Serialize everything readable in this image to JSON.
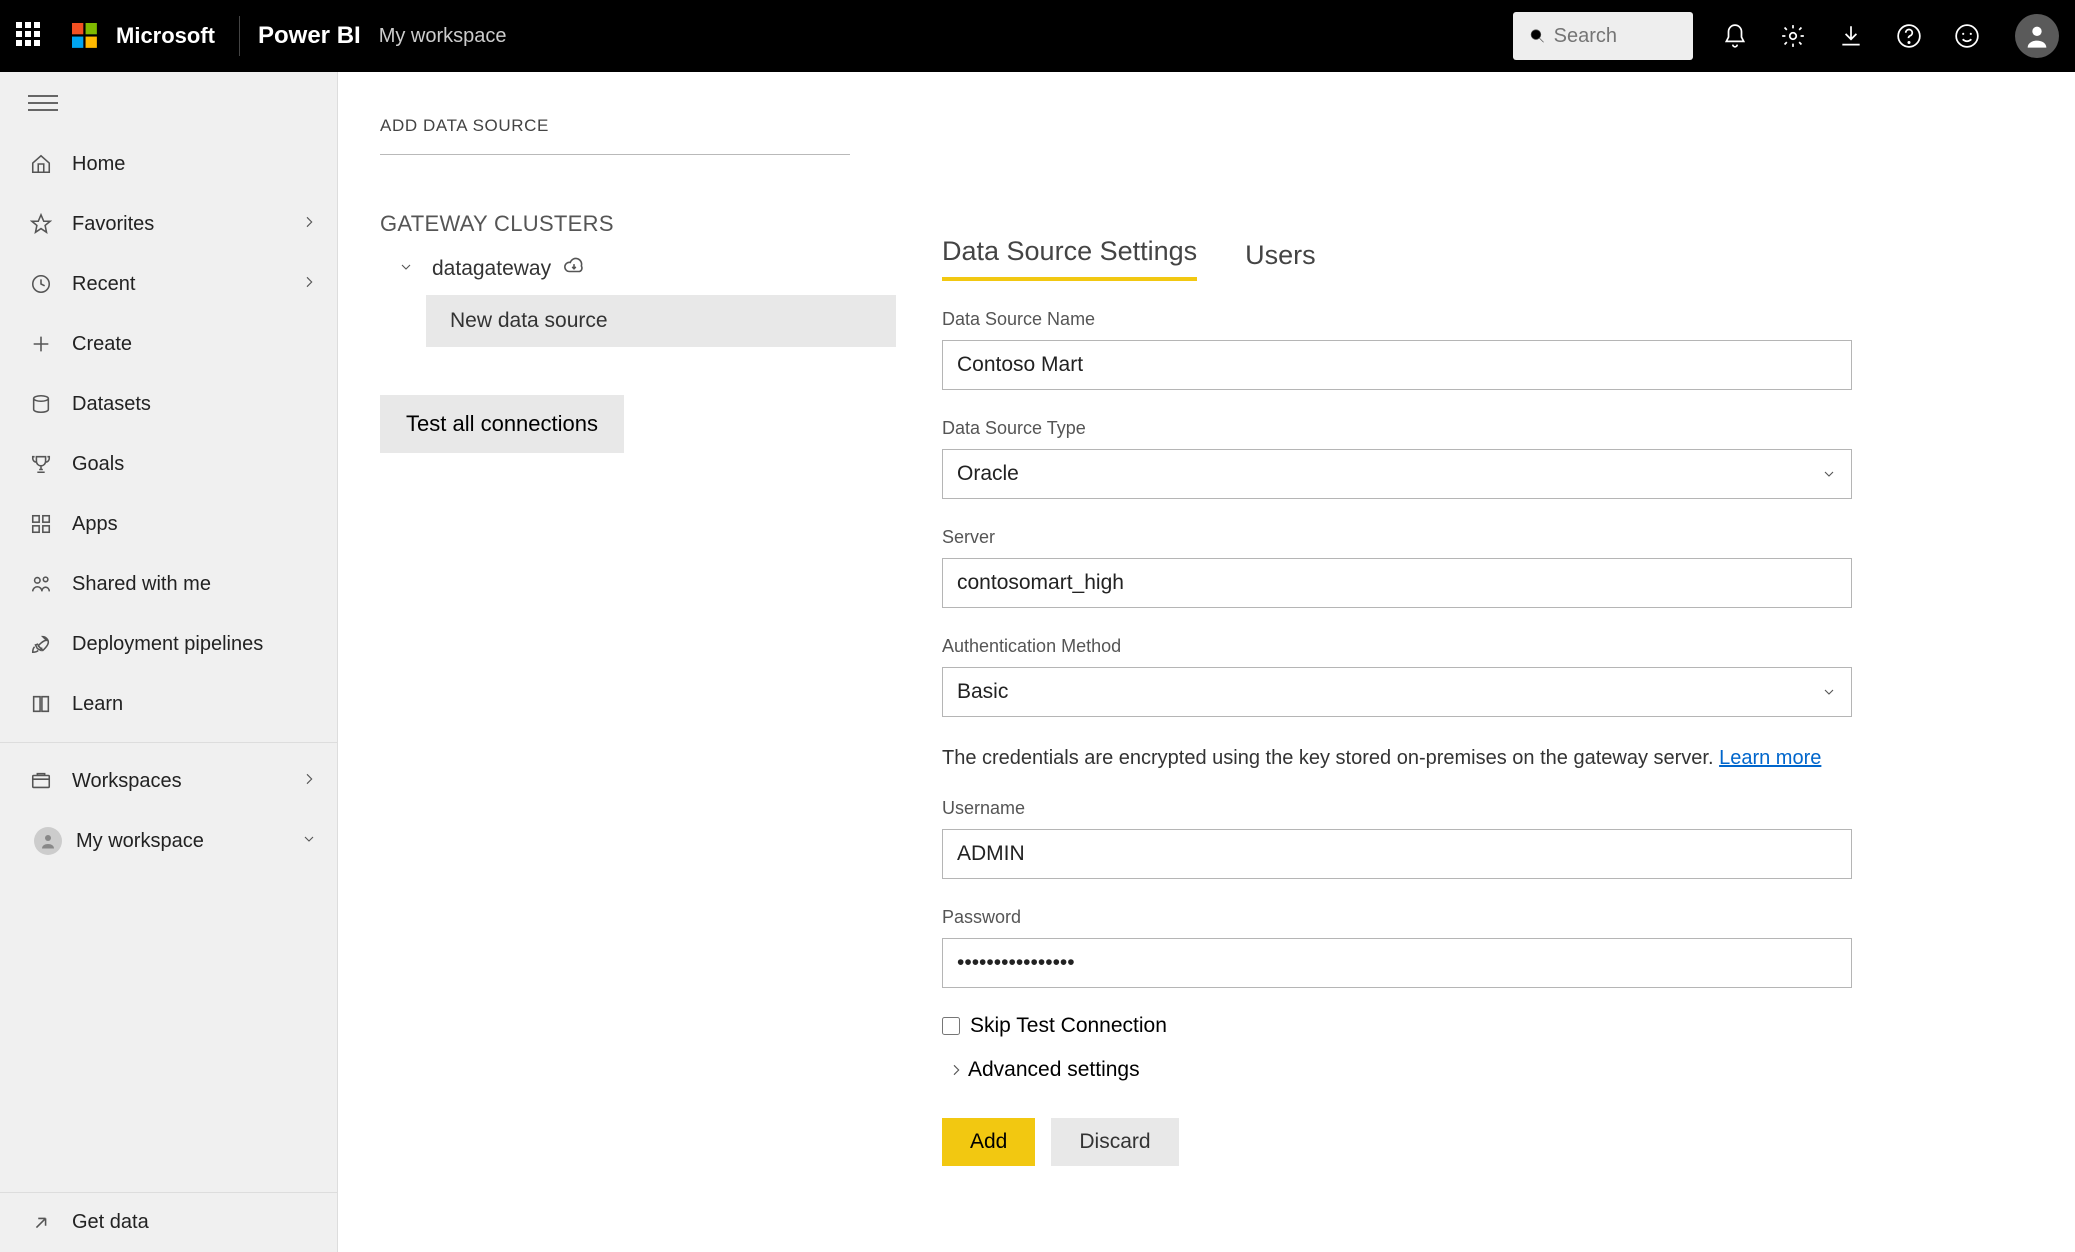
{
  "header": {
    "brand": "Microsoft",
    "product": "Power BI",
    "workspace": "My workspace",
    "search_placeholder": "Search"
  },
  "sidebar": {
    "items": {
      "home": "Home",
      "favorites": "Favorites",
      "recent": "Recent",
      "create": "Create",
      "datasets": "Datasets",
      "goals": "Goals",
      "apps": "Apps",
      "shared": "Shared with me",
      "pipelines": "Deployment pipelines",
      "learn": "Learn",
      "workspaces": "Workspaces",
      "myworkspace": "My workspace"
    },
    "get_data": "Get data"
  },
  "middle": {
    "title": "ADD DATA SOURCE",
    "gc_title": "GATEWAY CLUSTERS",
    "gateway_name": "datagateway",
    "new_ds": "New data source",
    "test_all": "Test all connections"
  },
  "tabs": {
    "settings": "Data Source Settings",
    "users": "Users"
  },
  "form": {
    "ds_name_label": "Data Source Name",
    "ds_name_value": "Contoso Mart",
    "ds_type_label": "Data Source Type",
    "ds_type_value": "Oracle",
    "server_label": "Server",
    "server_value": "contosomart_high",
    "auth_label": "Authentication Method",
    "auth_value": "Basic",
    "cred_info": "The credentials are encrypted using the key stored on-premises on the gateway server. ",
    "learn_more": "Learn more",
    "username_label": "Username",
    "username_value": "ADMIN",
    "password_label": "Password",
    "password_value": "••••••••••••••••",
    "skip_test": "Skip Test Connection",
    "advanced": "Advanced settings",
    "add_btn": "Add",
    "discard_btn": "Discard"
  }
}
